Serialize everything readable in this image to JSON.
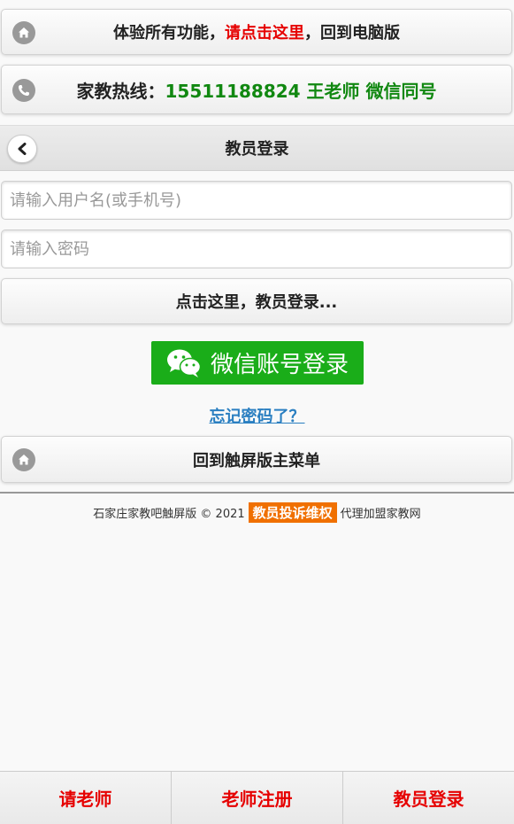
{
  "top_banner": {
    "text_before": "体验所有功能，",
    "link_text": "请点击这里",
    "text_after": "，回到电脑版"
  },
  "hotline": {
    "label": "家教热线：",
    "phone": "15511188824 王老师 微信同号"
  },
  "header": {
    "title": "教员登录"
  },
  "form": {
    "username_placeholder": "请输入用户名(或手机号)",
    "password_placeholder": "请输入密码",
    "username_value": "",
    "password_value": "",
    "login_button": "点击这里，教员登录..."
  },
  "wechat_login": {
    "label": "微信账号登录"
  },
  "forgot_password": "忘记密码了？",
  "home_button": "回到触屏版主菜单",
  "footer": {
    "text_before": "石家庄家教吧触屏版 © 2021",
    "badge": "教员投诉维权",
    "text_after": "代理加盟家教网"
  },
  "bottom_nav": [
    {
      "label": "请老师"
    },
    {
      "label": "老师注册"
    },
    {
      "label": "教员登录"
    }
  ],
  "colors": {
    "accent_red": "#e60000",
    "hotline_green": "#118811",
    "wechat_green": "#1aad19",
    "badge_orange": "#f07000",
    "link_blue": "#2a7fc1"
  },
  "icons": [
    "home-icon",
    "phone-icon",
    "back-chevron-icon",
    "wechat-icon"
  ]
}
